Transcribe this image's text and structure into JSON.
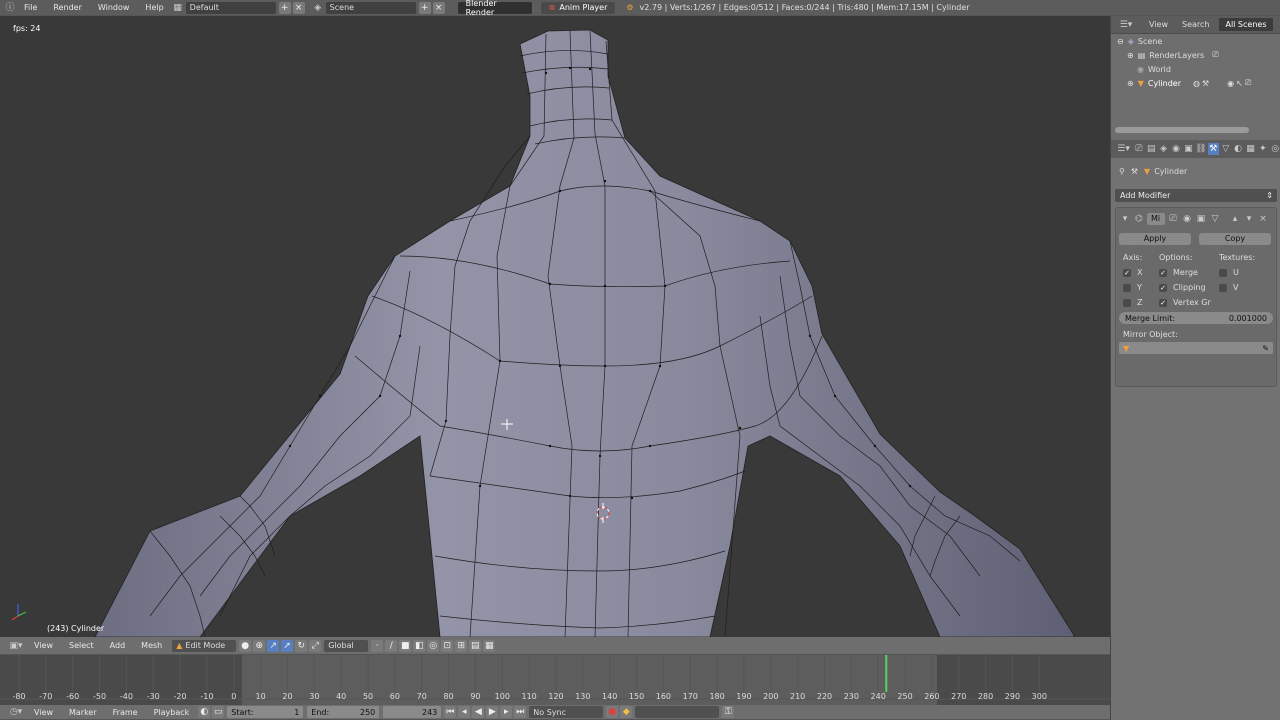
{
  "topbar": {
    "menus": [
      "File",
      "Render",
      "Window",
      "Help"
    ],
    "layout": "Default",
    "scene": "Scene",
    "engine": "Blender Render",
    "anim_player": "Anim Player",
    "stats": "v2.79 | Verts:1/267 | Edges:0/512 | Faces:0/244 | Tris:480 | Mem:17.15M | Cylinder"
  },
  "viewport": {
    "fps": "fps: 24",
    "object": "(243) Cylinder"
  },
  "vheader": {
    "menus": [
      "View",
      "Select",
      "Add",
      "Mesh"
    ],
    "mode": "Edit Mode",
    "orientation": "Global"
  },
  "timeline": {
    "ticks": [
      "-80",
      "-70",
      "-60",
      "-50",
      "-40",
      "-30",
      "-20",
      "-10",
      "0",
      "10",
      "20",
      "30",
      "40",
      "50",
      "60",
      "70",
      "80",
      "90",
      "100",
      "110",
      "120",
      "130",
      "140",
      "150",
      "160",
      "170",
      "180",
      "190",
      "200",
      "210",
      "220",
      "230",
      "240",
      "250",
      "260",
      "270",
      "280",
      "290",
      "300"
    ],
    "current_frame": 243
  },
  "tlhead": {
    "menus": [
      "View",
      "Marker",
      "Frame",
      "Playback"
    ],
    "start_label": "Start:",
    "start": "1",
    "end_label": "End:",
    "end": "250",
    "frame": "243",
    "sync": "No Sync"
  },
  "outliner": {
    "tabs": [
      "View",
      "Search",
      "All Scenes"
    ],
    "items": [
      "Scene",
      "RenderLayers",
      "World",
      "Cylinder"
    ]
  },
  "props": {
    "object": "Cylinder",
    "add_modifier": "Add Modifier",
    "mod_name": "Mi",
    "apply": "Apply",
    "copy": "Copy",
    "axis_label": "Axis:",
    "options_label": "Options:",
    "textures_label": "Textures:",
    "axes": [
      "X",
      "Y",
      "Z"
    ],
    "options": [
      "Merge",
      "Clipping",
      "Vertex Gr"
    ],
    "textures": [
      "U",
      "V"
    ],
    "merge_limit_label": "Merge Limit:",
    "merge_limit": "0.001000",
    "mirror_object_label": "Mirror Object:"
  },
  "colors": {
    "mesh": "#8e8ea0",
    "accent": "#5680c2",
    "playhead": "#5ad35a"
  }
}
